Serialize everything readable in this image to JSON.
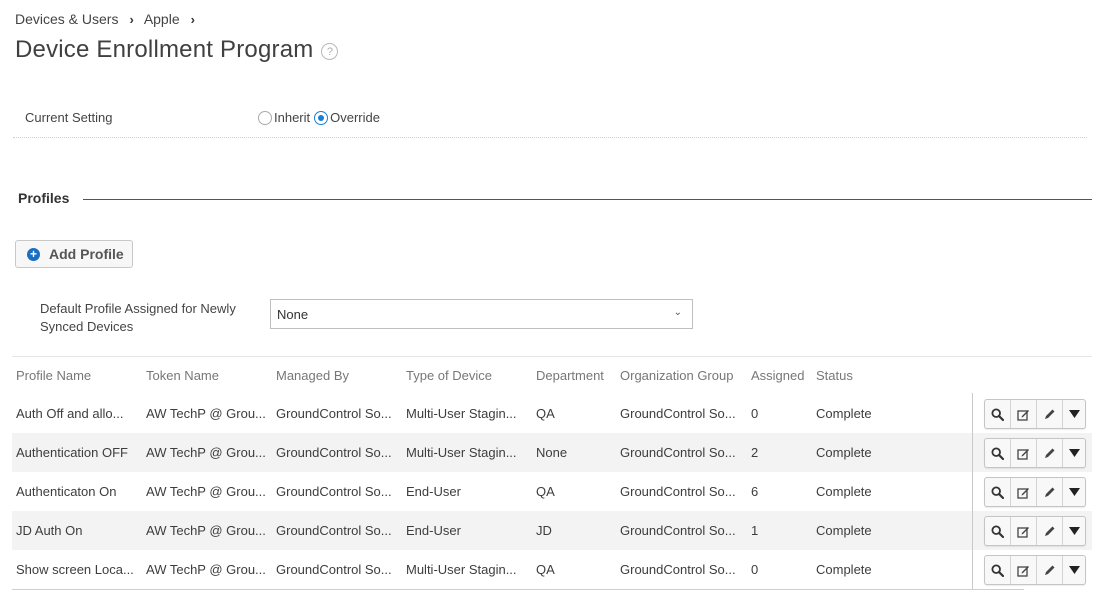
{
  "breadcrumb": [
    "Devices & Users",
    "Apple"
  ],
  "page": {
    "title": "Device Enrollment Program"
  },
  "setting": {
    "label": "Current Setting",
    "options": [
      "Inherit",
      "Override"
    ],
    "selected": "Override"
  },
  "profiles": {
    "section_title": "Profiles",
    "add_button": "Add Profile",
    "default_label": "Default Profile Assigned for Newly Synced Devices",
    "default_value": "None"
  },
  "table": {
    "columns": [
      "Profile Name",
      "Token Name",
      "Managed By",
      "Type of Device",
      "Department",
      "Organization Group",
      "Assigned",
      "Status"
    ],
    "rows": [
      [
        "Auth Off and allo...",
        "AW TechP @ Grou...",
        "GroundControl So...",
        "Multi-User Stagin...",
        "QA",
        "GroundControl So...",
        "0",
        "Complete"
      ],
      [
        "Authentication OFF",
        "AW TechP @ Grou...",
        "GroundControl So...",
        "Multi-User Stagin...",
        "None",
        "GroundControl So...",
        "2",
        "Complete"
      ],
      [
        "Authenticaton On",
        "AW TechP @ Grou...",
        "GroundControl So...",
        "End-User",
        "QA",
        "GroundControl So...",
        "6",
        "Complete"
      ],
      [
        "JD Auth On",
        "AW TechP @ Grou...",
        "GroundControl So...",
        "End-User",
        "JD",
        "GroundControl So...",
        "1",
        "Complete"
      ],
      [
        "Show screen Loca...",
        "AW TechP @ Grou...",
        "GroundControl So...",
        "Multi-User Stagin...",
        "QA",
        "GroundControl So...",
        "0",
        "Complete"
      ]
    ],
    "row_actions": [
      "search-icon",
      "edit-icon",
      "pencil-icon",
      "more-icon"
    ]
  },
  "colors": {
    "accent": "#1a7fd4",
    "plus": "#1a6fc0",
    "alt_row": "#f3f3f3"
  }
}
